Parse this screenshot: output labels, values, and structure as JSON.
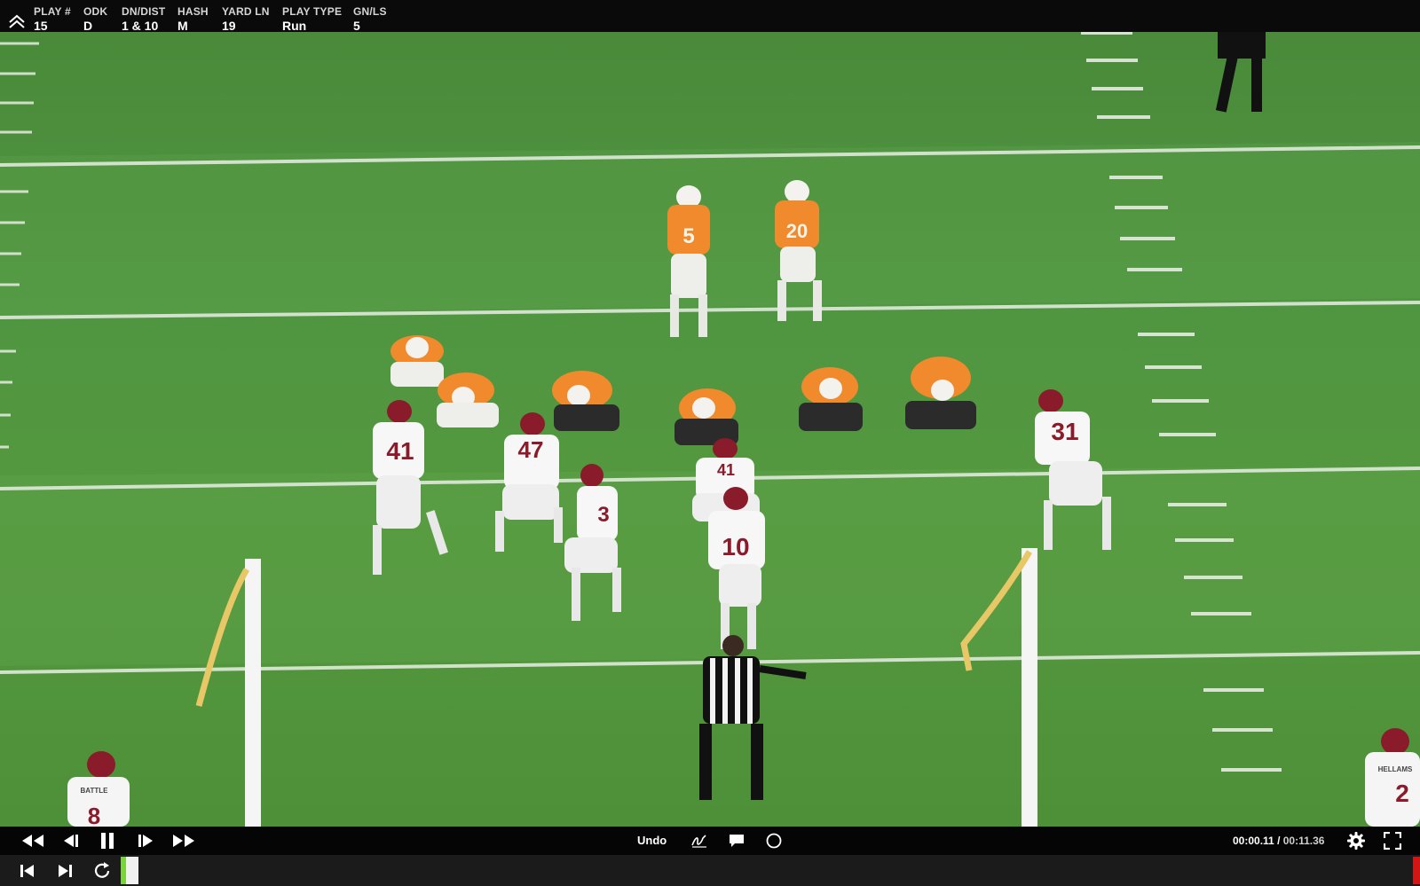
{
  "info_bar": {
    "columns": [
      {
        "label": "PLAY #",
        "value": "15"
      },
      {
        "label": "ODK",
        "value": "D"
      },
      {
        "label": "DN/DIST",
        "value": "1 & 10"
      },
      {
        "label": "HASH",
        "value": "M"
      },
      {
        "label": "YARD LN",
        "value": "19"
      },
      {
        "label": "PLAY TYPE",
        "value": "Run"
      },
      {
        "label": "GN/LS",
        "value": "5"
      }
    ]
  },
  "video": {
    "offense_numbers": [
      "41",
      "47",
      "3",
      "10",
      "31",
      "41",
      "8",
      "2"
    ],
    "defense_numbers": [
      "5",
      "20"
    ],
    "nameplates": [
      "BATTLE",
      "HELLAMS"
    ]
  },
  "controls": {
    "undo_label": "Undo",
    "current_time": "00:00.11",
    "separator": "/",
    "total_time": "00:11.36"
  },
  "colors": {
    "field": "#4f9440",
    "defense_jersey": "#f08a2c",
    "offense_number": "#8a1b2b",
    "progress": "#7ad23c",
    "end_marker": "#d21515"
  }
}
